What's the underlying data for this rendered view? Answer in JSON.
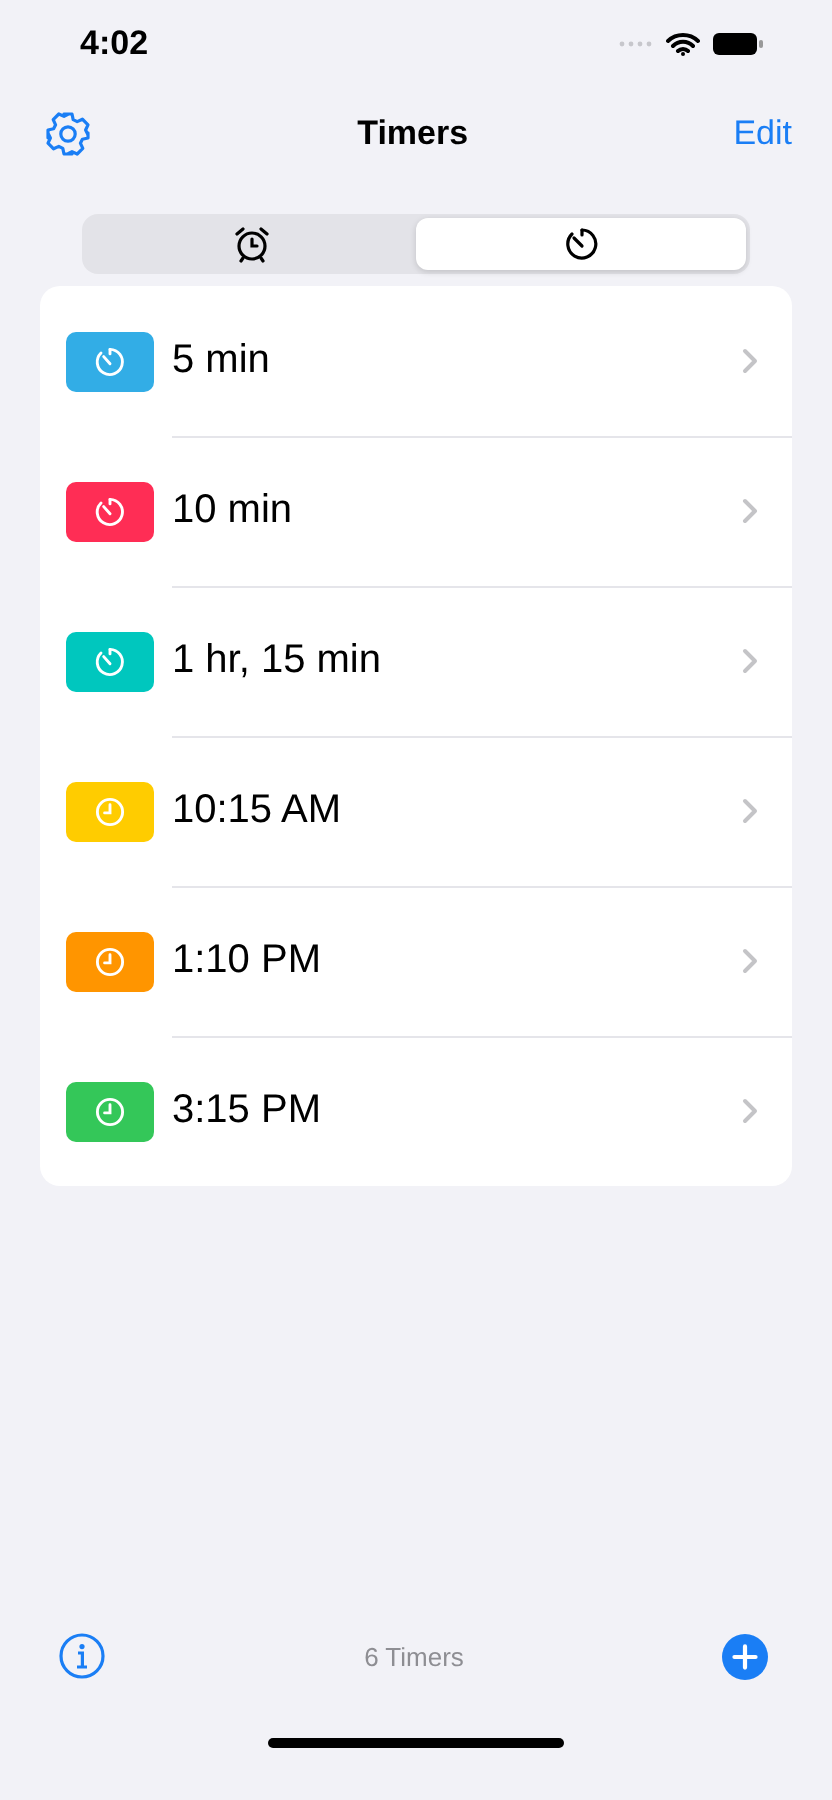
{
  "status_bar": {
    "time": "4:02"
  },
  "nav": {
    "title": "Timers",
    "edit": "Edit"
  },
  "segments": [
    {
      "kind": "alarm",
      "selected": false
    },
    {
      "kind": "timer",
      "selected": true
    }
  ],
  "timers": [
    {
      "label": "5 min",
      "kind": "timer",
      "color": "#32ade6"
    },
    {
      "label": "10 min",
      "kind": "timer",
      "color": "#ff2d55"
    },
    {
      "label": "1 hr, 15 min",
      "kind": "timer",
      "color": "#00c7be"
    },
    {
      "label": "10:15 AM",
      "kind": "clock",
      "color": "#ffcc00"
    },
    {
      "label": "1:10 PM",
      "kind": "clock",
      "color": "#ff9500"
    },
    {
      "label": "3:15 PM",
      "kind": "clock",
      "color": "#34c759"
    }
  ],
  "toolbar": {
    "count": "6 Timers"
  }
}
